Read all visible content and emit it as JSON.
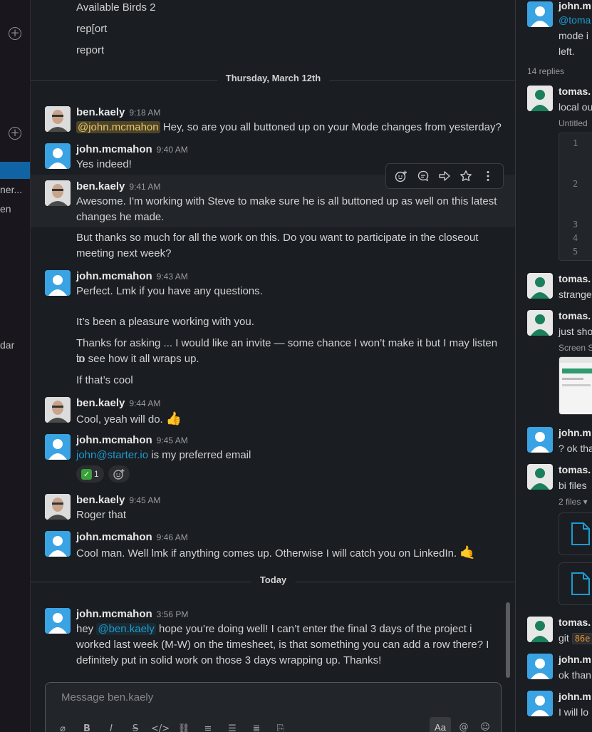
{
  "sidebar": {
    "partial_items": [
      "ner...",
      "en",
      "dar"
    ]
  },
  "main": {
    "previous_lines": [
      "Available Birds 2",
      "rep[ort",
      "report"
    ],
    "dividers": [
      "Thursday, March 12th",
      "Today"
    ],
    "messages": [
      {
        "sender": "ben.kaely",
        "time": "9:18 AM",
        "mention": "@john.mcmahon",
        "text": " Hey, so are you all buttoned up on your Mode changes from yesterday?"
      },
      {
        "sender": "john.mcmahon",
        "time": "9:40 AM",
        "text": "Yes indeed!"
      },
      {
        "sender": "ben.kaely",
        "time": "9:41 AM",
        "lines": [
          "Awesome. I'm working with Steve to make sure he is all buttoned up as well on this latest",
          "changes he made."
        ]
      },
      {
        "cont_lines": [
          "But thanks so much for all the work on this. Do you want to participate in the closeout",
          "meeting next week?"
        ]
      },
      {
        "sender": "john.mcmahon",
        "time": "9:43 AM",
        "lines": [
          "Perfect.  Lmk if you have any questions."
        ]
      },
      {
        "cont_lines": [
          "It’s been a pleasure working with you."
        ]
      },
      {
        "cont_lines": [
          "Thanks for asking ... I would like an invite — some chance I won’t make it but I may listen in",
          "to see how it all wraps up."
        ]
      },
      {
        "cont_lines": [
          "If that’s cool"
        ]
      },
      {
        "sender": "ben.kaely",
        "time": "9:44 AM",
        "text": "Cool, yeah will do. ",
        "emoji": "👍"
      },
      {
        "sender": "john.mcmahon",
        "time": "9:45 AM",
        "link": "john@starter.io",
        "text": " is my preferred email",
        "reaction_count": "1"
      },
      {
        "sender": "ben.kaely",
        "time": "9:45 AM",
        "text": "Roger that"
      },
      {
        "sender": "john.mcmahon",
        "time": "9:46 AM",
        "text": "Cool man. Well lmk if anything comes up. Otherwise I will catch you on LinkedIn. ",
        "emoji": "🤙"
      },
      {
        "sender": "john.mcmahon",
        "time": "3:56 PM",
        "line1_pre": "hey ",
        "mention": "@ben.kaely",
        "line1_post": " hope you’re doing well!  I can’t enter the final 3 days of the project i",
        "lines": [
          "worked last week (M-W) on the timesheet, is that something you can add a row there? I",
          "definitely put in solid work on those 3 days wrapping up. Thanks!"
        ]
      }
    ],
    "composer": {
      "placeholder": "Message ben.kaely",
      "aa_label": "Aa"
    }
  },
  "thread": {
    "items": [
      {
        "name": "john.m",
        "lines": [
          "@toma",
          "mode i",
          "left."
        ]
      },
      {
        "meta": "14 replies"
      },
      {
        "name": "tomas.",
        "lines": [
          "local ou"
        ],
        "meta": "Untitled"
      },
      {
        "name": "tomas.",
        "lines": [
          "strange"
        ]
      },
      {
        "name": "tomas.",
        "lines": [
          "just sho"
        ],
        "meta": "Screen S"
      },
      {
        "name": "john.m",
        "lines": [
          "? ok tha"
        ]
      },
      {
        "name": "tomas.",
        "lines": [
          "bi files"
        ],
        "meta": "2 files ▾"
      },
      {
        "name": "tomas.",
        "pre": "git ",
        "code": "86e"
      },
      {
        "name": "john.m",
        "lines": [
          "ok than"
        ]
      },
      {
        "name": "john.m",
        "lines": [
          "I will lo"
        ]
      }
    ],
    "code_line_numbers": [
      "1",
      "2",
      "3",
      "4",
      "5"
    ]
  },
  "colors": {
    "accent": "#1164a3",
    "link": "#1d9bd1",
    "mention_yellow": "#e8c46b",
    "john_avatar": "#3aa3e3",
    "tomas_avatar": "#1a7f5a"
  }
}
